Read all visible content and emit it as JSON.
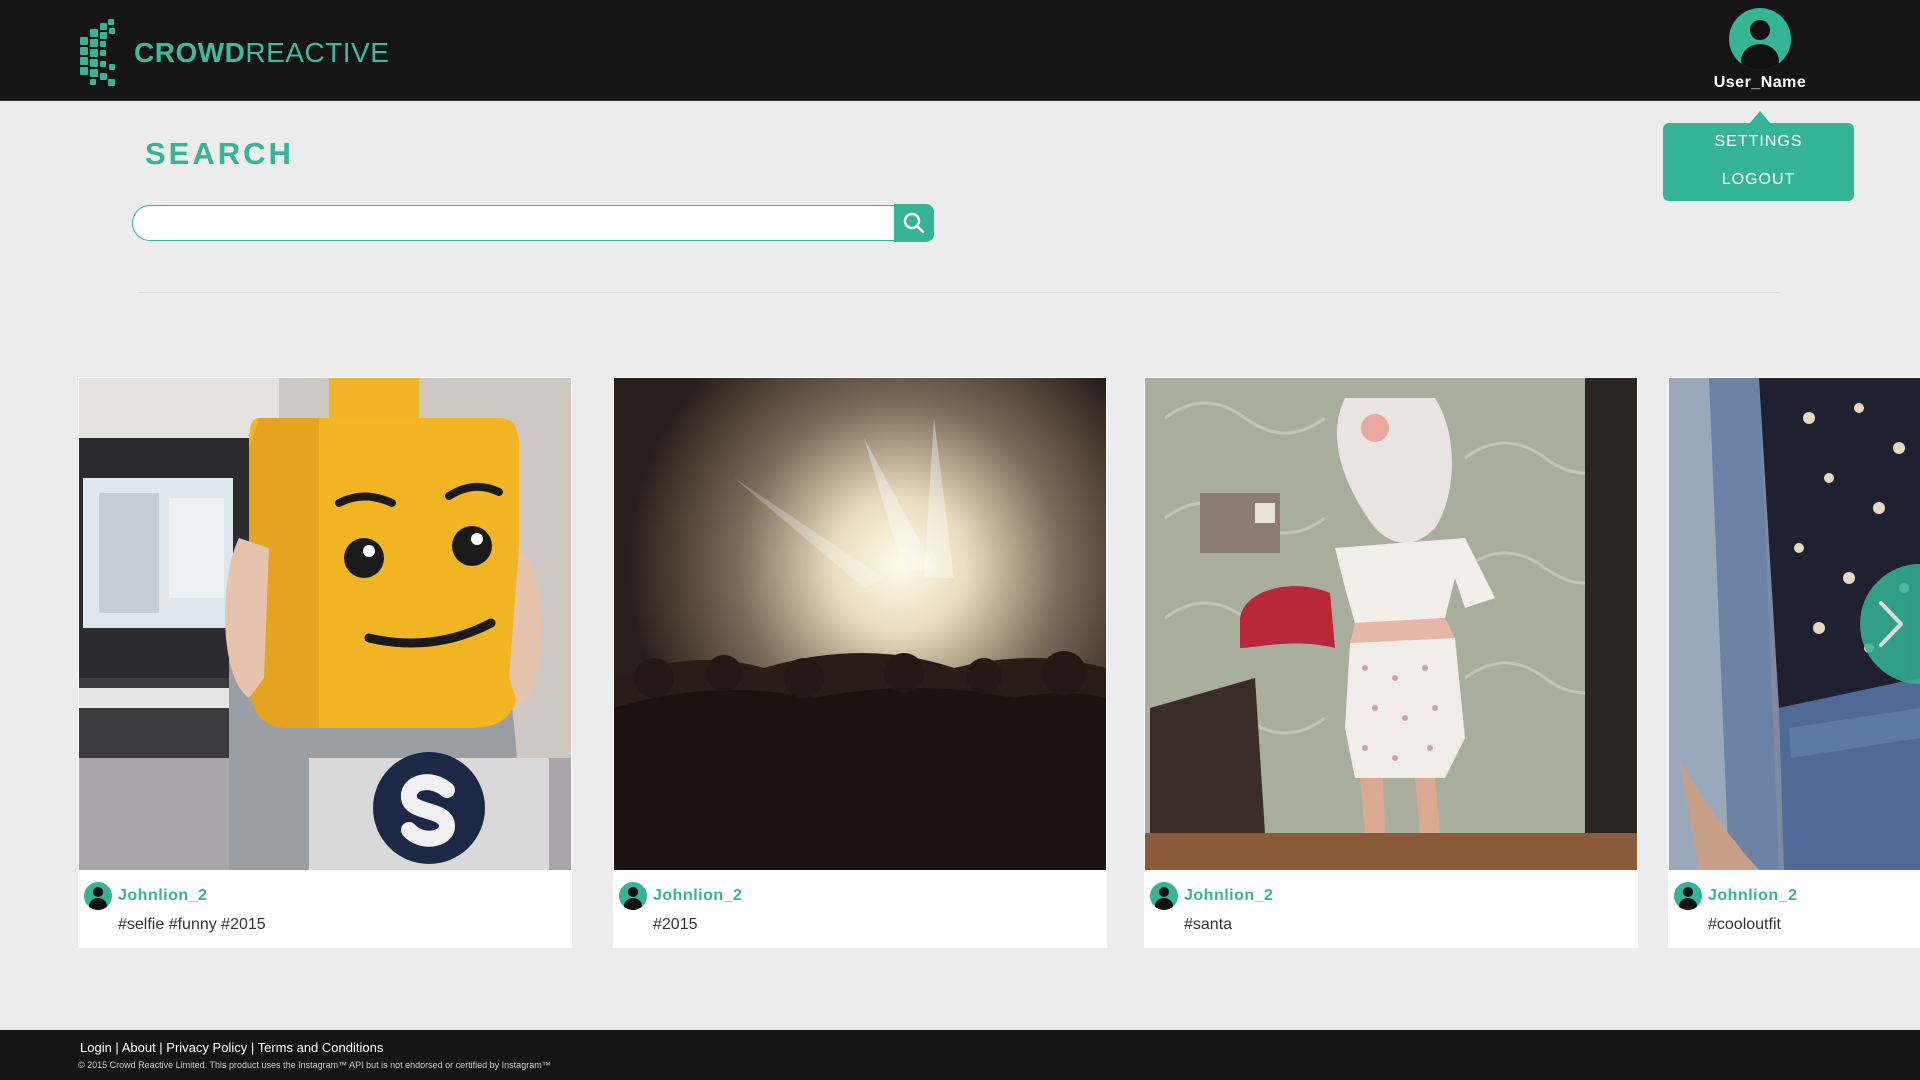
{
  "header": {
    "logo_bold": "CROWD",
    "logo_light": "REACTIVE",
    "username": "User_Name"
  },
  "user_menu": {
    "settings": "SETTINGS",
    "logout": "LOGOUT"
  },
  "search": {
    "title": "SEARCH",
    "value": "",
    "placeholder": ""
  },
  "cards": [
    {
      "username": "Johnlion_2",
      "tags": "#selfie #funny #2015"
    },
    {
      "username": "Johnlion_2",
      "tags": "#2015"
    },
    {
      "username": "Johnlion_2",
      "tags": "#santa"
    },
    {
      "username": "Johnlion_2",
      "tags": "#cooloutfit"
    }
  ],
  "footer": {
    "links": [
      "Login",
      "About",
      "Privacy Policy",
      "Terms and Conditions"
    ],
    "copyright": "© 2015 Crowd Reactive Limited. This product uses the Instagram™ API but is not endorsed or certified by Instagram™"
  },
  "colors": {
    "accent": "#35b496",
    "header_bg": "#151515",
    "page_bg": "#ececec"
  },
  "icons": [
    "logo-icon",
    "user-avatar-icon",
    "search-icon",
    "chevron-right-icon"
  ]
}
